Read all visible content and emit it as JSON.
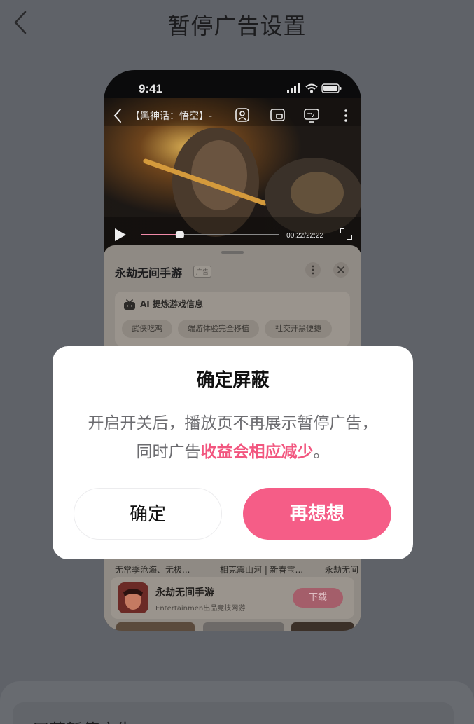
{
  "header": {
    "title": "暂停广告设置",
    "back_icon": "chevron-left-icon"
  },
  "phone": {
    "status_time": "9:41",
    "video": {
      "title": "【黑神话：悟空】-",
      "time": "00:22/22:22",
      "progress_fraction": 0.28,
      "toolbar_icons": [
        "back-icon",
        "cast-person-icon",
        "pip-icon",
        "tv-icon",
        "more-icon"
      ]
    },
    "ad_sheet": {
      "title": "永劫无间手游",
      "tag": "广告",
      "ai_label": "AI 提炼游戏信息",
      "chips": [
        "武侠吃鸡",
        "端游体验完全移植",
        "社交开黑便捷"
      ],
      "snippets": [
        "无常季沧海、无极...",
        "相克震山河 | 新春宝...",
        "永劫无间"
      ],
      "app": {
        "name": "永劫无间手游",
        "subtitle": "Entertainmen出品竞技网游",
        "download_label": "下载"
      }
    }
  },
  "dialog": {
    "title": "确定屏蔽",
    "body_prefix": "开启开关后，播放页不再展示暂停广告，同时广告",
    "body_highlight": "收益会相应减少",
    "body_suffix": "。",
    "confirm_label": "确定",
    "cancel_label": "再想想",
    "accent_color": "#f55d87"
  },
  "bottom_panel": {
    "label": "屏蔽暂停广告"
  }
}
